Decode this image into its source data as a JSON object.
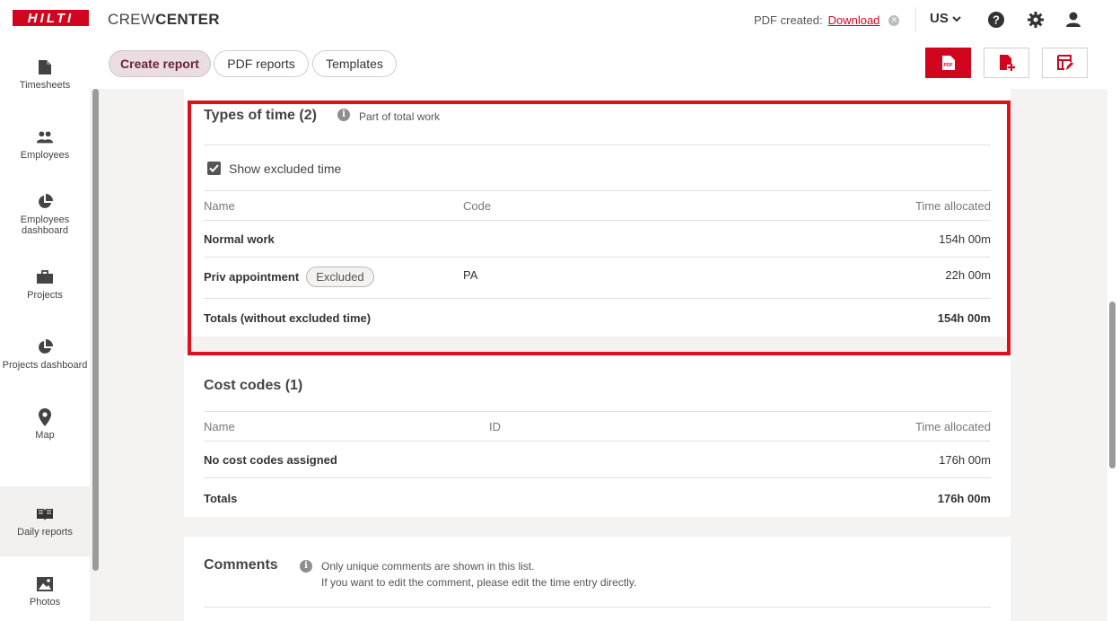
{
  "header": {
    "logo_text": "HILTI",
    "brand_light": "CREW",
    "brand_bold": "CENTER",
    "pdf_label": "PDF created:",
    "pdf_link": "Download",
    "region": "US"
  },
  "sidebar": {
    "items": [
      {
        "label": "Timesheets",
        "icon": "file-icon"
      },
      {
        "label": "Employees",
        "icon": "people-icon"
      },
      {
        "label": "Employees dashboard",
        "icon": "pie-chart-icon"
      },
      {
        "label": "Projects",
        "icon": "briefcase-icon"
      },
      {
        "label": "Projects dashboard",
        "icon": "pie-chart-icon"
      },
      {
        "label": "Map",
        "icon": "pin-icon"
      },
      {
        "label": "Daily reports",
        "icon": "book-icon"
      },
      {
        "label": "Photos",
        "icon": "image-icon"
      }
    ]
  },
  "tabs": {
    "create_report": "Create report",
    "pdf_reports": "PDF reports",
    "templates": "Templates"
  },
  "types_of_time": {
    "title": "Types of time (2)",
    "hint": "Part of total work",
    "show_excluded": "Show excluded time",
    "col_name": "Name",
    "col_code": "Code",
    "col_time": "Time allocated",
    "rows": [
      {
        "name": "Normal work",
        "code": "",
        "time": "154h 00m",
        "badge": ""
      },
      {
        "name": "Priv appointment",
        "code": "PA",
        "time": "22h 00m",
        "badge": "Excluded"
      }
    ],
    "totals_label": "Totals (without excluded time)",
    "totals_value": "154h 00m"
  },
  "cost_codes": {
    "title": "Cost codes (1)",
    "col_name": "Name",
    "col_id": "ID",
    "col_time": "Time allocated",
    "row_name": "No cost codes assigned",
    "row_time": "176h 00m",
    "totals_label": "Totals",
    "totals_value": "176h 00m"
  },
  "comments": {
    "title": "Comments",
    "hint_line1": "Only unique comments are shown in this list.",
    "hint_line2": "If you want to edit the comment, please edit the time entry directly."
  },
  "colors": {
    "brand_red": "#d2051e",
    "highlight": "#e0101a"
  }
}
